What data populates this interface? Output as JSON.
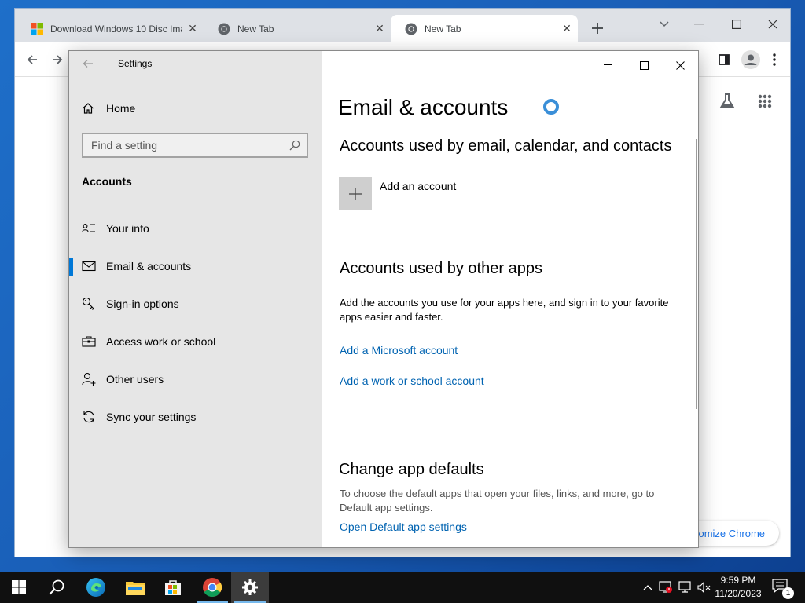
{
  "browser": {
    "tabs": [
      {
        "title": "Download Windows 10 Disc Ima",
        "favicon": "windows-logo-icon"
      },
      {
        "title": "New Tab",
        "favicon": "chrome-icon"
      },
      {
        "title": "New Tab",
        "favicon": "chrome-icon",
        "active": true
      }
    ],
    "customize_label": "Customize Chrome",
    "customize_visible": "stomize Chrome"
  },
  "settings": {
    "app_title": "Settings",
    "home_label": "Home",
    "search_placeholder": "Find a setting",
    "section_title": "Accounts",
    "nav": [
      {
        "label": "Your info",
        "icon": "contact-card-icon"
      },
      {
        "label": "Email & accounts",
        "icon": "mail-icon",
        "selected": true
      },
      {
        "label": "Sign-in options",
        "icon": "key-icon"
      },
      {
        "label": "Access work or school",
        "icon": "briefcase-icon"
      },
      {
        "label": "Other users",
        "icon": "add-person-icon"
      },
      {
        "label": "Sync your settings",
        "icon": "sync-icon"
      }
    ],
    "page_title": "Email & accounts",
    "email_section": {
      "heading": "Accounts used by email, calendar, and contacts",
      "add_account_label": "Add an account"
    },
    "other_apps_section": {
      "heading": "Accounts used by other apps",
      "description": "Add the accounts you use for your apps here, and sign in to your favorite apps easier and faster.",
      "add_microsoft_link": "Add a Microsoft account",
      "add_work_link": "Add a work or school account"
    },
    "defaults_section": {
      "heading": "Change app defaults",
      "description": "To choose the default apps that open your files, links, and more, go to Default app settings.",
      "open_link": "Open Default app settings"
    },
    "accent_color": "#0078d7",
    "link_color": "#0063b1"
  },
  "taskbar": {
    "time": "9:59 PM",
    "date": "11/20/2023",
    "notification_count": "1",
    "pinned": [
      "start-icon",
      "search-icon",
      "edge-icon",
      "file-explorer-icon",
      "store-icon",
      "chrome-icon",
      "settings-icon"
    ]
  }
}
